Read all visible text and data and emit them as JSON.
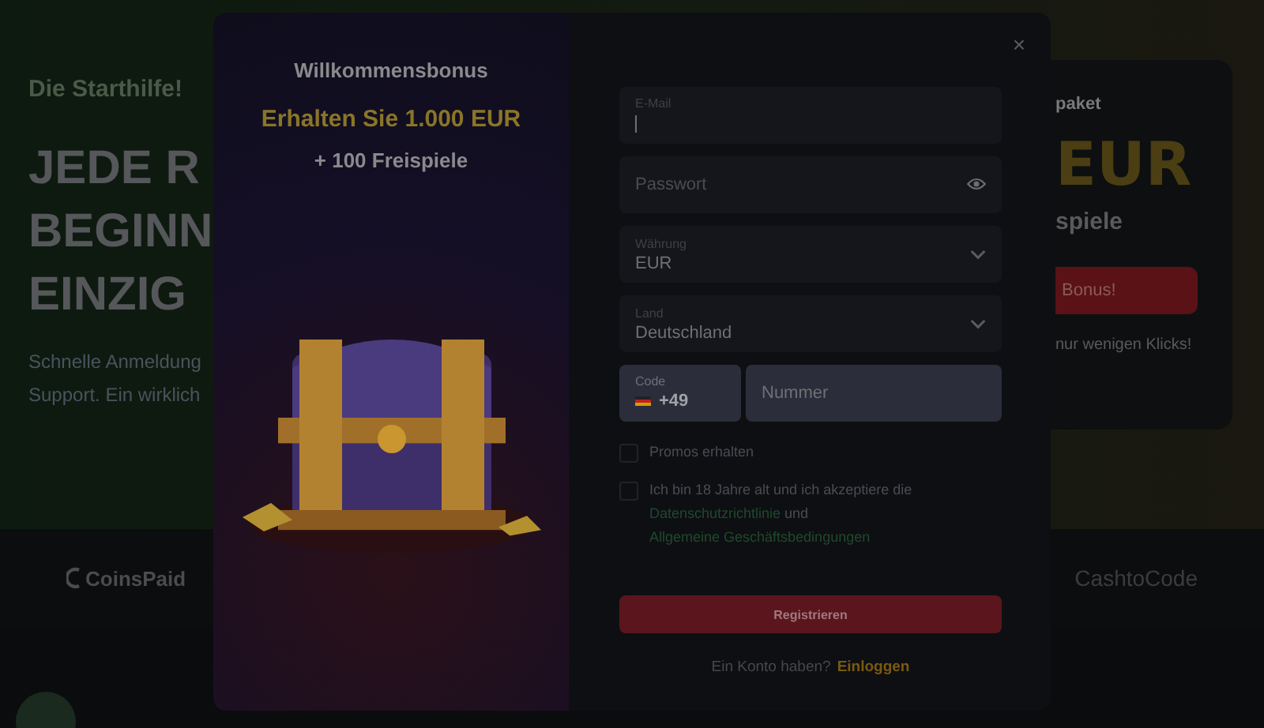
{
  "background": {
    "hero": {
      "kicker": "Die Starthilfe!",
      "title_lines": [
        "JEDE R",
        "BEGINN",
        "EINZIG"
      ],
      "text_lines": [
        "Schnelle Anmeldung",
        "Support. Ein wirklich"
      ]
    },
    "promo_card": {
      "label": "paket",
      "amount": "EUR",
      "spins": "spiele",
      "button": "Bonus!",
      "note": "nur wenigen Klicks!"
    },
    "payment_logos": [
      "CoinsPaid",
      "CashtoCode"
    ]
  },
  "modal": {
    "bonus": {
      "title": "Willkommensbonus",
      "amount": "Erhalten Sie 1.000 EUR",
      "spins": "+ 100 Freispiele"
    },
    "close": "×",
    "fields": [
      {
        "kind": "text",
        "label": "E-Mail",
        "focused": true
      },
      {
        "kind": "password",
        "placeholder": "Passwort"
      },
      {
        "kind": "select",
        "label": "Währung",
        "value": "EUR"
      },
      {
        "kind": "select",
        "label": "Land",
        "value": "Deutschland"
      }
    ],
    "phone": {
      "code_label": "Code",
      "code": "+49",
      "placeholder": "Nummer"
    },
    "checkboxes": [
      {
        "kind": "plain",
        "label": "Promos erhalten",
        "checked": false
      },
      {
        "kind": "terms",
        "label": "Ich bin 18 Jahre alt und ich akzeptiere die",
        "link1": "Datenschutzrichtlinie",
        "joiner": "und",
        "link2": "Allgemeine Geschäftsbedingungen",
        "checked": false
      }
    ],
    "submit": "Registrieren",
    "login_prompt": "Ein Konto haben?",
    "login_link": "Einloggen"
  }
}
